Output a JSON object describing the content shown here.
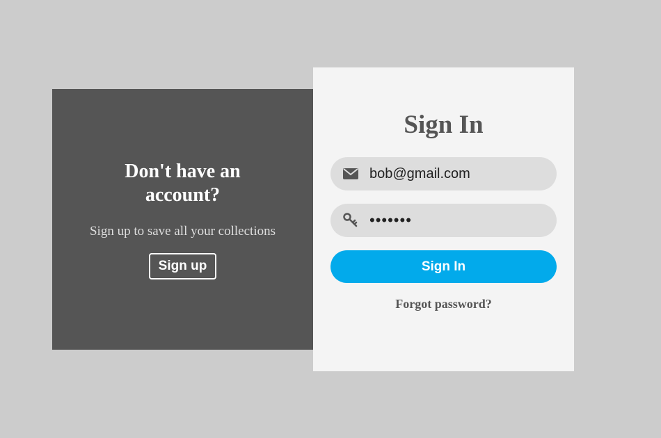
{
  "colors": {
    "background": "#cccccc",
    "left_panel": "#555555",
    "right_panel": "#f4f4f4",
    "field_bg": "#dddddd",
    "accent": "#02aaeb",
    "text_dark": "#555555"
  },
  "signup_panel": {
    "title": "Don't have an account?",
    "subtitle": "Sign up to save all your collections",
    "button_label": "Sign up"
  },
  "signin_panel": {
    "title": "Sign In",
    "email": {
      "icon": "envelope-icon",
      "value": "bob@gmail.com"
    },
    "password": {
      "icon": "key-icon",
      "value": "•••••••"
    },
    "submit_label": "Sign In",
    "forgot_label": "Forgot password?"
  }
}
